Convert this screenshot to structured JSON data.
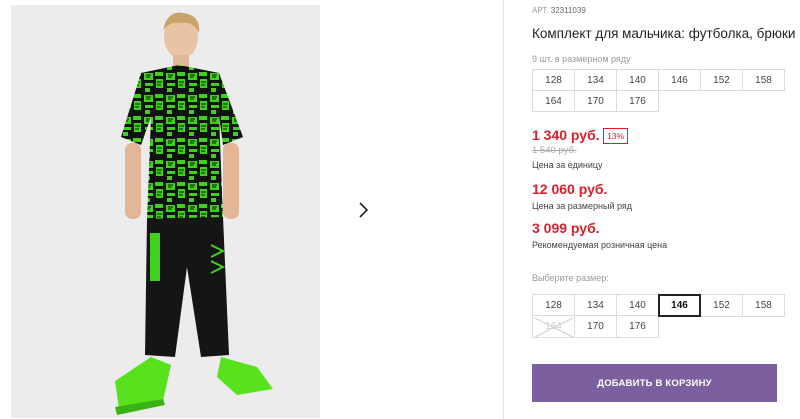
{
  "gallery": {
    "photo_alt": "",
    "next_icon": "chevron-right-icon"
  },
  "product": {
    "art_label": "АРТ.",
    "art_code": "32311039",
    "title": "Комплект для мальчика: футболка, брюки",
    "pack_note": "9 шт. в размерном ряду",
    "pack_sizes": [
      "128",
      "134",
      "140",
      "146",
      "152",
      "158",
      "164",
      "170",
      "176"
    ]
  },
  "pricing": {
    "unit_price": "1 340 руб.",
    "discount": "13%",
    "old_price": "1 540 руб.",
    "unit_caption": "Цена за единицу",
    "pack_price": "12 060 руб.",
    "pack_caption": "Цена за размерный ряд",
    "retail_price": "3 099 руб.",
    "retail_caption": "Рекомендуемая розничная цена"
  },
  "size_select": {
    "label": "Выберите размер:",
    "options": [
      "128",
      "134",
      "140",
      "146",
      "152",
      "158",
      "164",
      "170",
      "176"
    ],
    "selected": "146",
    "disabled": [
      "164"
    ]
  },
  "cart": {
    "button_label": "ДОБАВИТЬ В КОРЗИНУ"
  },
  "colors": {
    "price_red": "#d8202b",
    "button_purple": "#7b5f9e",
    "shirt_green": "#3fd11b"
  }
}
